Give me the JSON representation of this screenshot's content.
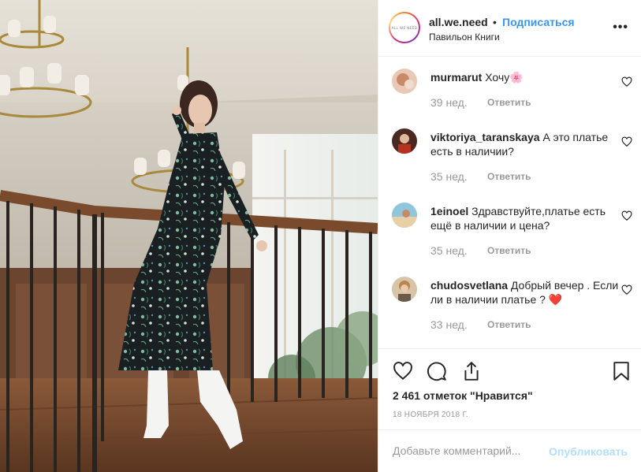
{
  "post": {
    "username": "all.we.need",
    "dot": "•",
    "follow_label": "Подписаться",
    "location": "Павильон Книги",
    "avatar_text": "ALL WE NEED",
    "more_label": "•••"
  },
  "comments": [
    {
      "username": "murmarut",
      "text": "Хочу🌸",
      "time": "39 нед.",
      "reply": "Ответить"
    },
    {
      "username": "viktoriya_taranskaya",
      "text": "А это платье есть в наличии?",
      "time": "35 нед.",
      "reply": "Ответить"
    },
    {
      "username": "1einoel",
      "text": "Здравствуйте,платье есть ещё в наличии и цена?",
      "time": "35 нед.",
      "reply": "Ответить"
    },
    {
      "username": "chudosvetlana",
      "text": "Добрый вечер . Если ли в наличии платье ? ❤️",
      "time": "33 нед.",
      "reply": "Ответить"
    }
  ],
  "likes": "2 461 отметок \"Нравится\"",
  "date": "18 НОЯБРЯ 2018 Г.",
  "add_comment": {
    "placeholder": "Добавьте комментарий...",
    "post_label": "Опубликовать"
  },
  "icons": {
    "like": "heart-icon",
    "comment": "comment-bubble-icon",
    "share": "share-icon",
    "save": "bookmark-icon"
  }
}
